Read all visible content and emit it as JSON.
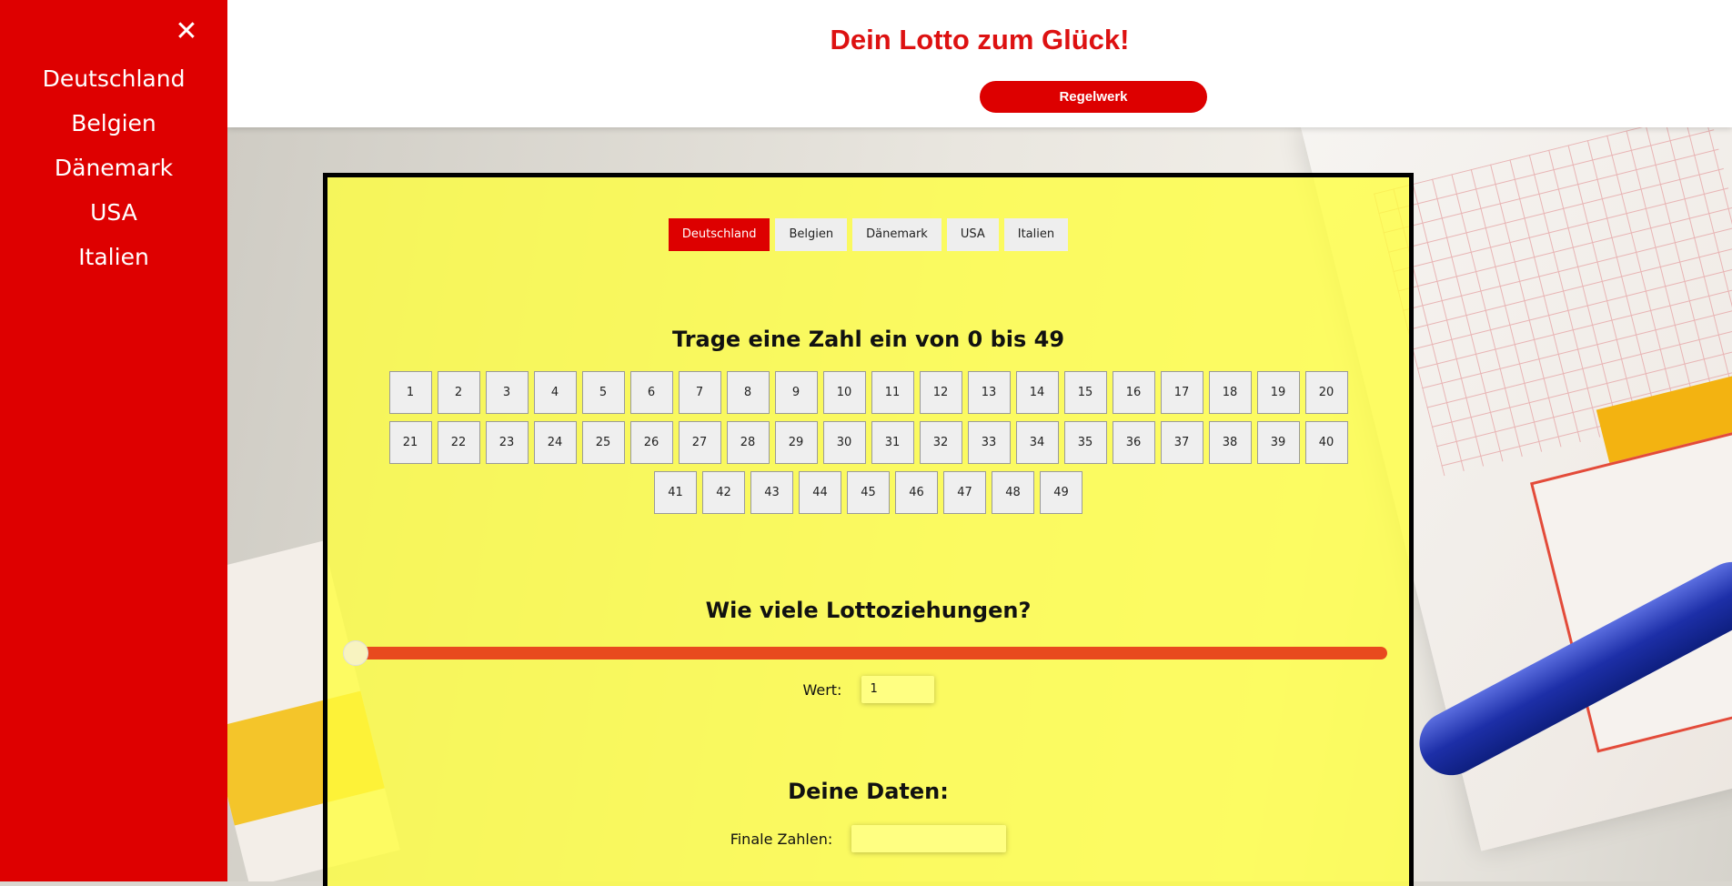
{
  "header": {
    "title": "Dein Lotto zum Glück!",
    "rules_button": "Regelwerk"
  },
  "sidebar": {
    "close_icon": "close-icon",
    "items": [
      {
        "label": "Deutschland"
      },
      {
        "label": "Belgien"
      },
      {
        "label": "Dänemark"
      },
      {
        "label": "USA"
      },
      {
        "label": "Italien"
      }
    ]
  },
  "tabs": [
    {
      "label": "Deutschland",
      "active": true
    },
    {
      "label": "Belgien",
      "active": false
    },
    {
      "label": "Dänemark",
      "active": false
    },
    {
      "label": "USA",
      "active": false
    },
    {
      "label": "Italien",
      "active": false
    }
  ],
  "numbers_section": {
    "heading": "Trage eine Zahl ein von 0 bis 49",
    "rows": [
      [
        "1",
        "2",
        "3",
        "4",
        "5",
        "6",
        "7",
        "8",
        "9",
        "10",
        "11",
        "12",
        "13",
        "14",
        "15",
        "16",
        "17",
        "18",
        "19",
        "20"
      ],
      [
        "21",
        "22",
        "23",
        "24",
        "25",
        "26",
        "27",
        "28",
        "29",
        "30",
        "31",
        "32",
        "33",
        "34",
        "35",
        "36",
        "37",
        "38",
        "39",
        "40"
      ],
      [
        "41",
        "42",
        "43",
        "44",
        "45",
        "46",
        "47",
        "48",
        "49"
      ]
    ]
  },
  "draws_section": {
    "heading": "Wie viele Lottoziehungen?",
    "slider_value_fraction": 0,
    "value_label": "Wert:",
    "value": "1"
  },
  "data_section": {
    "heading": "Deine Daten:",
    "final_label": "Finale Zahlen:",
    "final_value": ""
  },
  "colors": {
    "primary_red": "#dd0000",
    "card_yellow": "#ffff3c",
    "slider_orange": "#e84a1e"
  }
}
